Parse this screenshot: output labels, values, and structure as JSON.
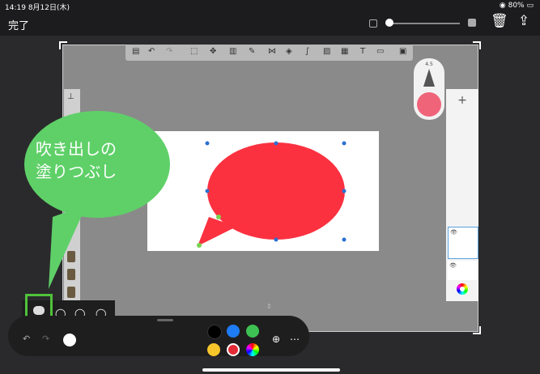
{
  "status": {
    "time": "14:19",
    "date": "8月12日(木)",
    "battery": "80%"
  },
  "top": {
    "done_label": "完了",
    "trash_icon": "trash-icon",
    "share_icon": "share-icon"
  },
  "pen": {
    "size": "4.5",
    "color": "#f0647a"
  },
  "callout": {
    "line1": "吹き出しの",
    "line2": "塗りつぶし"
  },
  "bubble_color": "#fb3140",
  "annotation_color": "#5fd068",
  "palette": [
    "#000000",
    "#1e7cf4",
    "#3ec153",
    "#f7c62b",
    "#e32b35",
    "rainbow"
  ],
  "layers": {
    "add_label": "+"
  }
}
